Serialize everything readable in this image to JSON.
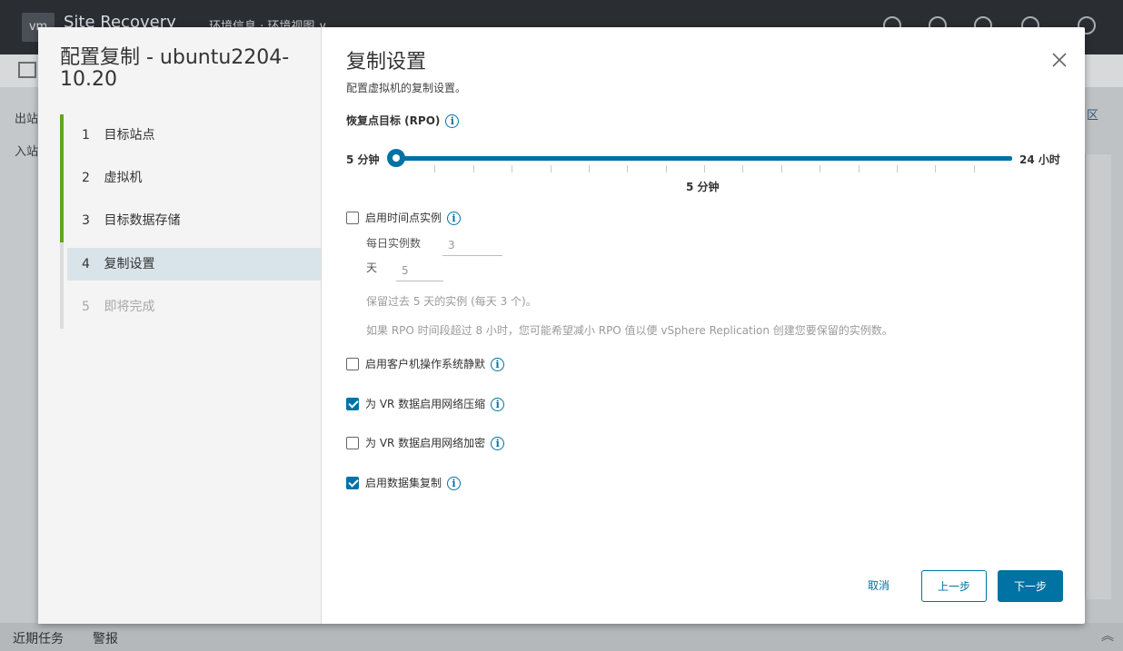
{
  "background": {
    "app_title": "Site Recovery",
    "header_crumb": "环境信息 · 环境视图 ∨",
    "left_items": [
      "出站",
      "入站"
    ],
    "right_link": "区",
    "footer_tabs": [
      "近期任务",
      "警报"
    ]
  },
  "wizard": {
    "title": "配置复制 - ubuntu2204-10.20",
    "steps": [
      {
        "num": "1",
        "label": "目标站点",
        "state": "done"
      },
      {
        "num": "2",
        "label": "虚拟机",
        "state": "done"
      },
      {
        "num": "3",
        "label": "目标数据存储",
        "state": "done"
      },
      {
        "num": "4",
        "label": "复制设置",
        "state": "active"
      },
      {
        "num": "5",
        "label": "即将完成",
        "state": "pending"
      }
    ]
  },
  "content": {
    "title": "复制设置",
    "subtitle": "配置虚拟机的复制设置。",
    "rpo": {
      "label": "恢复点目标 (RPO)",
      "min_label": "5 分钟",
      "max_label": "24 小时",
      "value_label": "5 分钟",
      "position_fraction": 0
    },
    "pit": {
      "label": "启用时间点实例",
      "checked": false,
      "instances_label": "每日实例数",
      "instances_value": "3",
      "days_label": "天",
      "days_value": "5",
      "retention_text": "保留过去 5 天的实例 (每天 3 个)。",
      "advice_text": "如果 RPO 时间段超过 8 小时，您可能希望减小 RPO 值以便 vSphere Replication 创建您要保留的实例数。"
    },
    "options": [
      {
        "label": "启用客户机操作系统静默",
        "checked": false
      },
      {
        "label": "为 VR 数据启用网络压缩",
        "checked": true
      },
      {
        "label": "为 VR 数据启用网络加密",
        "checked": false
      },
      {
        "label": "启用数据集复制",
        "checked": true
      }
    ],
    "buttons": {
      "cancel": "取消",
      "back": "上一步",
      "next": "下一步"
    }
  },
  "colors": {
    "accent": "#0072a3",
    "done_step": "#62a420",
    "active_step_bg": "#d9e4ea"
  }
}
